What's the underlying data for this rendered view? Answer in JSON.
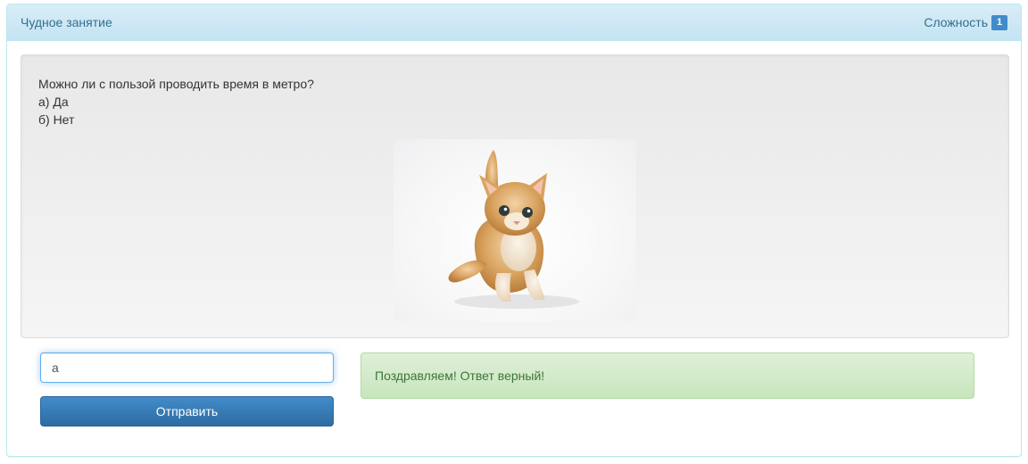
{
  "header": {
    "title": "Чудное занятие",
    "difficulty_label": "Сложность",
    "difficulty_value": "1"
  },
  "question": {
    "text": "Можно ли с пользой проводить время в метро?",
    "options": [
      "а) Да",
      "б) Нет"
    ]
  },
  "image": {
    "icon": "kitten-photo"
  },
  "answer": {
    "value": "а",
    "submit_label": "Отправить"
  },
  "feedback": {
    "message": "Поздравляем! Ответ верный!"
  },
  "colors": {
    "panel_border": "#bce8f1",
    "heading_text": "#31708f",
    "badge": "#428bca",
    "button": "#428bca",
    "success_bg": "#dff0d8",
    "success_text": "#3c763d"
  }
}
